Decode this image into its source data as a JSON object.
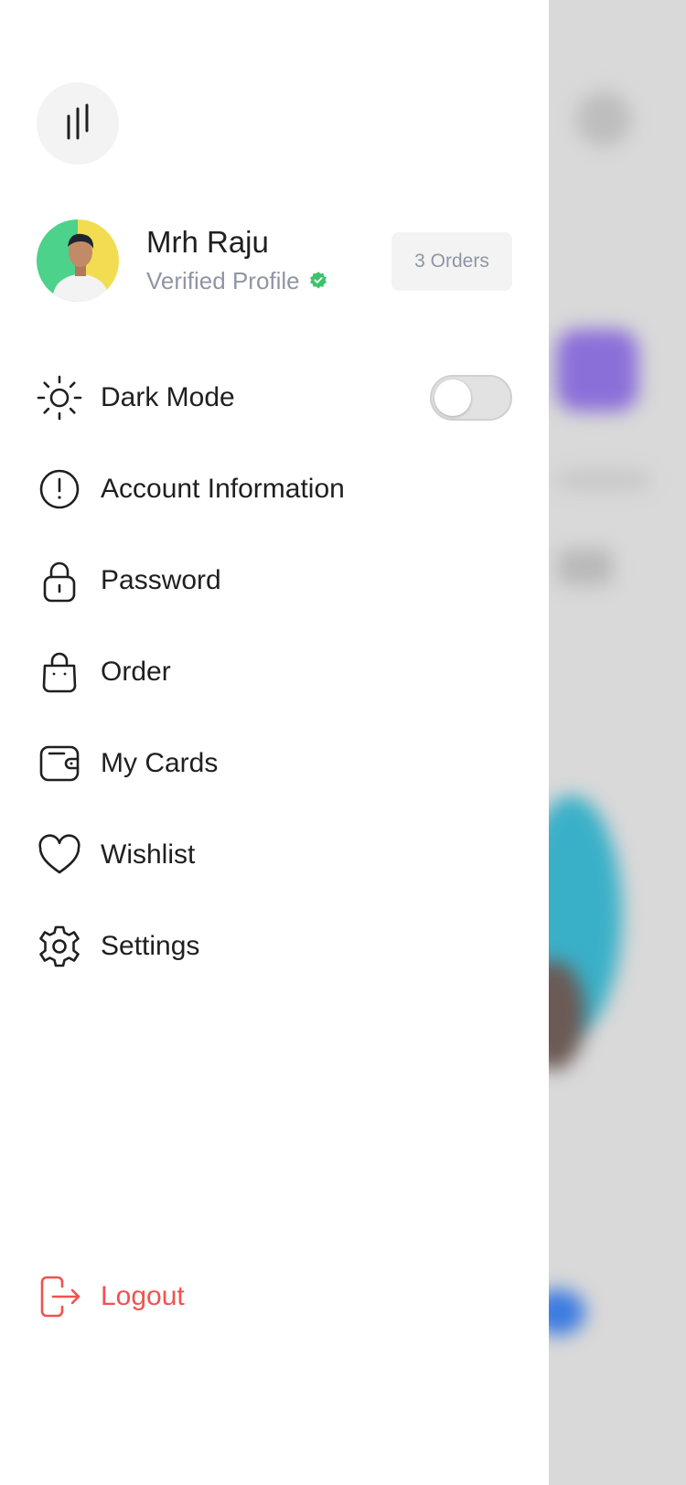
{
  "profile": {
    "name": "Mrh Raju",
    "status": "Verified Profile",
    "orders_badge": "3 Orders"
  },
  "menu": {
    "items": [
      {
        "label": "Dark Mode",
        "icon": "sun-icon"
      },
      {
        "label": "Account Information",
        "icon": "info-icon"
      },
      {
        "label": "Password",
        "icon": "lock-icon"
      },
      {
        "label": "Order",
        "icon": "bag-icon"
      },
      {
        "label": "My Cards",
        "icon": "wallet-icon"
      },
      {
        "label": "Wishlist",
        "icon": "heart-icon"
      },
      {
        "label": "Settings",
        "icon": "gear-icon"
      }
    ],
    "dark_mode_enabled": false
  },
  "logout": {
    "label": "Logout",
    "icon": "logout-icon"
  },
  "colors": {
    "accent_red": "#ef5350",
    "verified_green": "#3cc36b",
    "text": "#1f1f1f",
    "muted": "#8f96a3"
  }
}
